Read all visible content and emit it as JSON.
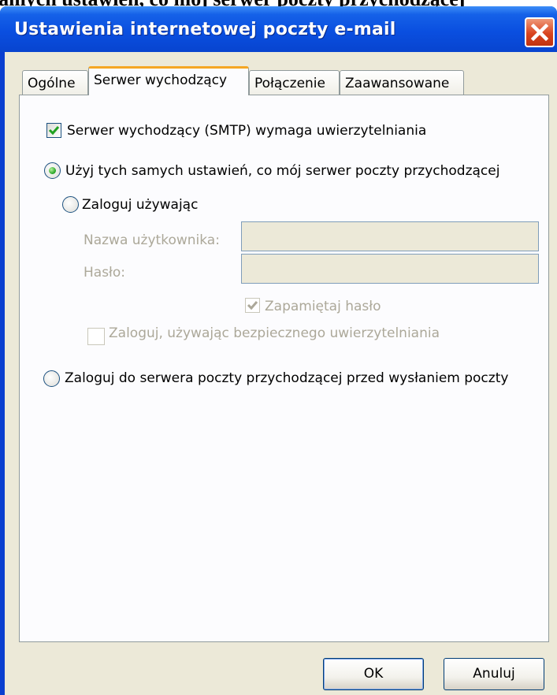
{
  "background_caption": "samych ustawień, co mój serwer poczty przychodzącej",
  "window": {
    "title": "Ustawienia internetowej poczty e-mail"
  },
  "tabs": [
    {
      "label": "Ogólne"
    },
    {
      "label": "Serwer wychodzący"
    },
    {
      "label": "Połączenie"
    },
    {
      "label": "Zaawansowane"
    }
  ],
  "smtp_auth": {
    "label": "Serwer wychodzący (SMTP) wymaga uwierzytelniania",
    "checked": true
  },
  "options": {
    "same_settings": {
      "label": "Użyj tych samych ustawień, co mój serwer poczty przychodzącej",
      "selected": true
    },
    "login_using": {
      "label": "Zaloguj używając",
      "selected": false
    },
    "username": {
      "label": "Nazwa użytkownika:",
      "value": ""
    },
    "password": {
      "label": "Hasło:",
      "value": ""
    },
    "remember_password": {
      "label": "Zapamiętaj hasło",
      "checked": true
    },
    "spa": {
      "label": "Zaloguj, używając bezpiecznego uwierzytelniania",
      "checked": false
    },
    "login_incoming_first": {
      "label": "Zaloguj do serwera poczty przychodzącej przed wysłaniem poczty",
      "selected": false
    }
  },
  "buttons": {
    "ok": "OK",
    "cancel": "Anuluj"
  },
  "colors": {
    "titlebar": "#0a4fe0",
    "dialog_face": "#ece9d8",
    "tab_active_accent": "#f5a623",
    "check_green": "#21a121",
    "close_red": "#d9441f",
    "disabled_text": "#aca899"
  },
  "icons": {
    "close": "close-icon",
    "check": "checkmark-icon",
    "radio": "radio-dot-icon"
  }
}
